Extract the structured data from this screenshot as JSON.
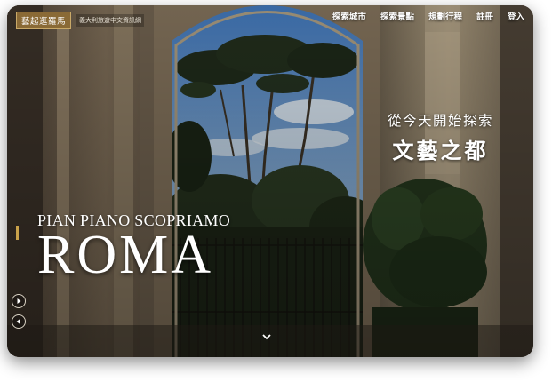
{
  "header": {
    "brand_name": "藝起逛羅馬",
    "brand_tagline": "義大利旅遊中文資訊網"
  },
  "nav": {
    "items": [
      {
        "label": "探索城市"
      },
      {
        "label": "探索景點"
      },
      {
        "label": "規劃行程"
      },
      {
        "label": "註冊"
      },
      {
        "label": "登入"
      }
    ]
  },
  "hero": {
    "slogan_line1": "從今天開始探索",
    "slogan_line2": "文藝之都",
    "subtitle": "PIAN PIANO SCOPRIAMO",
    "title": "ROMA"
  },
  "controls": {
    "icons": [
      "play-icon",
      "previous-icon",
      "chevron-down-icon"
    ]
  },
  "colors": {
    "accent_gold": "#c9a24a",
    "brand_badge": "#8a6a36"
  }
}
